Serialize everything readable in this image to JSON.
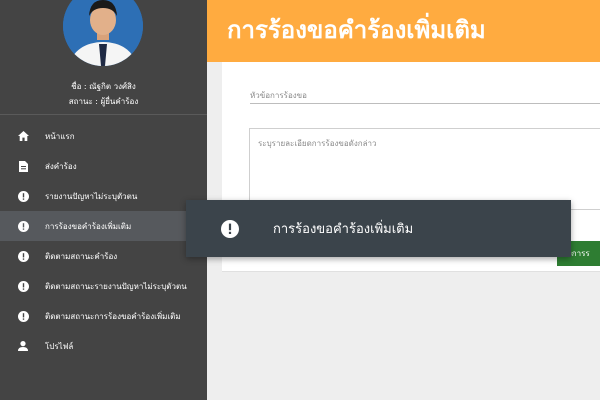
{
  "user": {
    "name": "ชื่อ : ณัฐกิต วงศ์สิง",
    "role": "สถานะ : ผู้ยื่นคำร้อง"
  },
  "sidebar": {
    "items": [
      {
        "label": "หน้าแรก",
        "icon": "home-icon"
      },
      {
        "label": "ส่งคำร้อง",
        "icon": "document-icon"
      },
      {
        "label": "รายงานปัญหาไม่ระบุตัวตน",
        "icon": "alert-circle-icon"
      },
      {
        "label": "การร้องขอคำร้องเพิ่มเติม",
        "icon": "alert-circle-icon",
        "active": true
      },
      {
        "label": "ติดตามสถานะคำร้อง",
        "icon": "alert-circle-icon"
      },
      {
        "label": "ติดตามสถานะรายงานปัญหาไม่ระบุตัวตน",
        "icon": "alert-circle-icon"
      },
      {
        "label": "ติดตามสถานะการร้องขอคำร้องเพิ่มเติม",
        "icon": "alert-circle-icon"
      },
      {
        "label": "โปรไฟล์",
        "icon": "person-icon"
      }
    ]
  },
  "header": {
    "title": "การร้องขอคำร้องเพิ่มเติม"
  },
  "form": {
    "topic_placeholder": "หัวข้อการร้องขอ",
    "detail_placeholder": "ระบุรายละเอียดการร้องขอดังกล่าว",
    "submit_label": "ส่งการร"
  },
  "toast": {
    "text": "การร้องขอคำร้องเพิ่มเติม",
    "icon": "alert-circle-icon"
  },
  "colors": {
    "sidebar_bg": "#444444",
    "header_accent": "#ffab40",
    "toast_bg": "#3b444b",
    "submit_green": "#2e7d32"
  }
}
